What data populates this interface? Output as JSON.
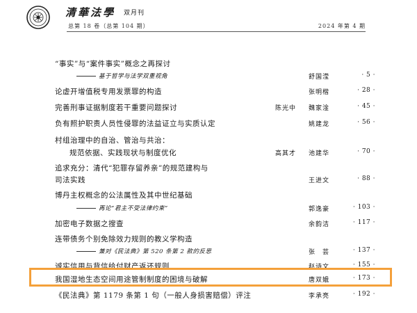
{
  "header": {
    "journal_title": "清華法學",
    "frequency": "双月刊",
    "volume": "总第 18 卷（总第 104 期）",
    "issue": "2024 年第 4 期"
  },
  "entries": [
    {
      "title": "“事实”与“案件事实”概念之再探讨",
      "sub": "基于哲学与法学双重视角",
      "author2": "",
      "author": "舒国滢",
      "page": "· 5 ·"
    },
    {
      "title": "论虚开增值税专用发票罪的构造",
      "author2": "",
      "author": "张明楷",
      "page": "· 28 ·"
    },
    {
      "title": "完善刑事证据制度若干重要问题探讨",
      "author2": "陈光中",
      "author": "魏家淦",
      "page": "· 45 ·"
    },
    {
      "title": "负有照护职责人员性侵罪的法益证立与实质认定",
      "author2": "",
      "author": "姚建龙",
      "page": "· 56 ·"
    },
    {
      "title": "村组治理中的自治、管治与共治：",
      "line2": "规范依据、实践现状与制度优化",
      "author2": "高其才",
      "author": "池建华",
      "page": "· 70 ·"
    },
    {
      "title": "追求充分：清代“犯罪存留养亲”的规范建构与",
      "line2": "司法实践",
      "author2": "",
      "author": "王进文",
      "page": "· 88 ·"
    },
    {
      "title": "博丹主权概念的公法属性及其中世纪基础",
      "sub": "再论“君主不受法律约束”",
      "author2": "",
      "author": "郭逸豪",
      "page": "· 103 ·"
    },
    {
      "title": "加密电子数据之搜查",
      "author2": "",
      "author": "余韵洁",
      "page": "· 117 ·"
    },
    {
      "title": "连带债务个别免除效力规则的教义学构造",
      "sub": "兼对《民法典》第 520 条第 2 款的反思",
      "author2": "",
      "author": "张　芸",
      "page": "· 137 ·"
    },
    {
      "title": "诚实信用与背信给付财产返还规则",
      "author2": "",
      "author": "赵诗文",
      "page": "· 155 ·"
    },
    {
      "title": "我国湿地生态空间用途管制制度的困境与破解",
      "author2": "",
      "author": "唐双娥",
      "page": "· 173 ·"
    },
    {
      "title": "《民法典》第 1179 条第 1 句（一般人身损害赔偿）评注",
      "author2": "",
      "author": "李承亮",
      "page": "· 192 ·"
    }
  ],
  "colors": {
    "highlight": "#f4a03a"
  }
}
